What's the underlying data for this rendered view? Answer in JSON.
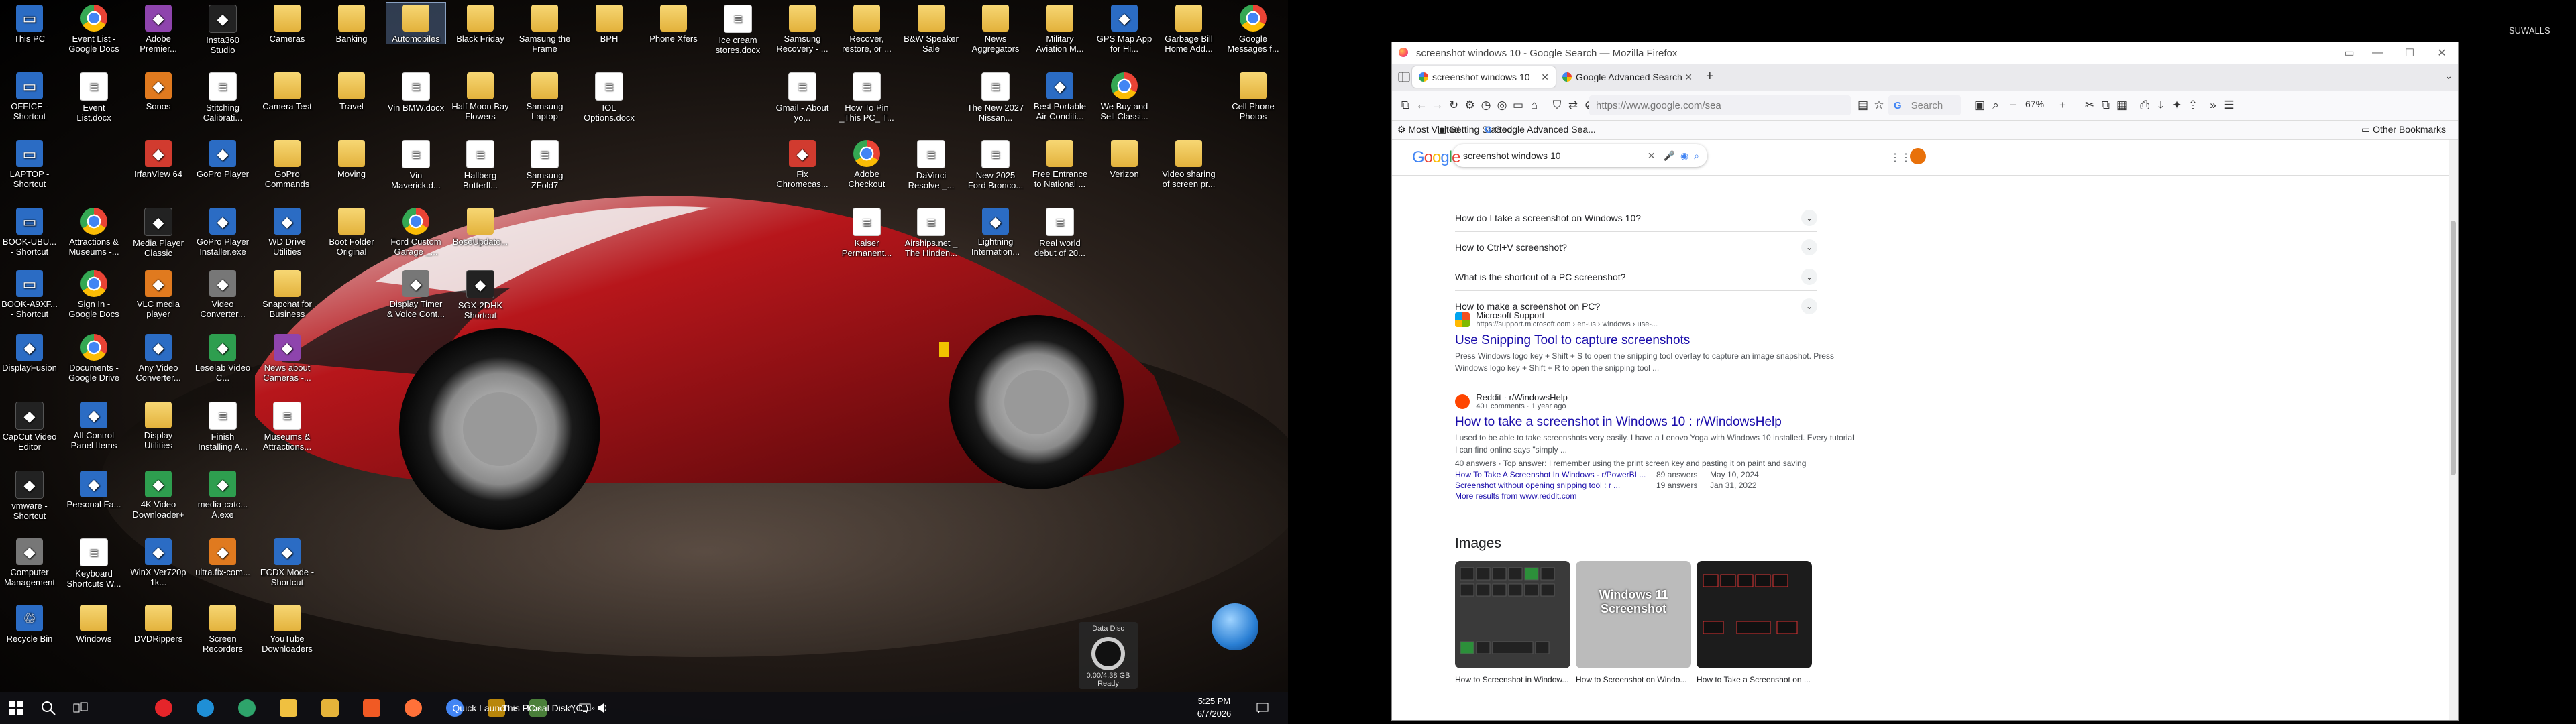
{
  "left_monitor": {
    "desktop_icons": [
      {
        "label": "This PC",
        "icon": "pc-icon",
        "x": 2,
        "y": 2,
        "kind": "app"
      },
      {
        "label": "Event List - Google Docs",
        "icon": "chrome-icon",
        "kind": "chrome"
      },
      {
        "label": "Adobe Premier...",
        "icon": "app-icon",
        "kind": "purple"
      },
      {
        "label": "Insta360 Studio",
        "icon": "app-icon",
        "kind": "dark"
      },
      {
        "label": "Cameras",
        "icon": "folder-icon",
        "kind": "folder"
      },
      {
        "label": "Banking",
        "icon": "folder-icon",
        "kind": "folder"
      },
      {
        "label": "Automobiles",
        "icon": "folder-icon",
        "kind": "folder",
        "selected": true
      },
      {
        "label": "Black Friday",
        "icon": "folder-icon",
        "kind": "folder"
      },
      {
        "label": "Samsung the Frame",
        "icon": "folder-icon",
        "kind": "folder"
      },
      {
        "label": "BPH",
        "icon": "folder-icon",
        "kind": "folder"
      },
      {
        "label": "Phone Xfers",
        "icon": "folder-icon",
        "kind": "folder"
      },
      {
        "label": "Ice cream stores.docx",
        "icon": "document-icon",
        "kind": "doc"
      },
      {
        "label": "Samsung Recovery - ...",
        "icon": "folder-icon",
        "kind": "folder"
      },
      {
        "label": "Recover, restore, or ...",
        "icon": "folder-icon",
        "kind": "folder"
      },
      {
        "label": "B&W Speaker Sale",
        "icon": "folder-icon",
        "kind": "folder"
      },
      {
        "label": "News Aggregators",
        "icon": "folder-icon",
        "kind": "folder"
      },
      {
        "label": "Military Aviation M...",
        "icon": "folder-icon",
        "kind": "folder"
      },
      {
        "label": "GPS Map App for Hi...",
        "icon": "app-icon",
        "kind": "app"
      },
      {
        "label": "Garbage Bill Home Add...",
        "icon": "folder-icon",
        "kind": "folder"
      },
      {
        "label": "Google Messages f...",
        "icon": "chrome-icon",
        "kind": "chrome"
      },
      {
        "label": "OFFICE - Shortcut",
        "icon": "pc-icon",
        "kind": "app"
      },
      {
        "label": "Event List.docx",
        "icon": "document-icon",
        "kind": "doc"
      },
      {
        "label": "Sonos",
        "icon": "app-icon",
        "kind": "orange"
      },
      {
        "label": "Stitching Calibrati...",
        "icon": "document-icon",
        "kind": "doc"
      },
      {
        "label": "Camera Test",
        "icon": "folder-icon",
        "kind": "folder"
      },
      {
        "label": "Travel",
        "icon": "folder-icon",
        "kind": "folder"
      },
      {
        "label": "Vin BMW.docx",
        "icon": "document-icon",
        "kind": "doc"
      },
      {
        "label": "Half Moon Bay Flowers",
        "icon": "folder-icon",
        "kind": "folder"
      },
      {
        "label": "Samsung Laptop",
        "icon": "folder-icon",
        "kind": "folder"
      },
      {
        "label": "IOL Options.docx",
        "icon": "document-icon",
        "kind": "doc"
      },
      {
        "label": "Gmail - About yo...",
        "icon": "document-icon",
        "kind": "doc"
      },
      {
        "label": "How To Pin _This PC_ T...",
        "icon": "document-icon",
        "kind": "doc"
      },
      {
        "label": "The New 2027 Nissan...",
        "icon": "document-icon",
        "kind": "doc"
      },
      {
        "label": "Best Portable Air Conditi...",
        "icon": "app-icon",
        "kind": "app"
      },
      {
        "label": "We Buy and Sell Classi...",
        "icon": "chrome-icon",
        "kind": "chrome"
      },
      {
        "label": "Cell Phone Photos",
        "icon": "folder-icon",
        "kind": "folder"
      },
      {
        "label": "LAPTOP - Shortcut",
        "icon": "pc-icon",
        "kind": "app"
      },
      {
        "label": "IrfanView 64",
        "icon": "app-icon",
        "kind": "red"
      },
      {
        "label": "GoPro Player",
        "icon": "app-icon",
        "kind": "app"
      },
      {
        "label": "GoPro Commands",
        "icon": "folder-icon",
        "kind": "folder"
      },
      {
        "label": "Moving",
        "icon": "folder-icon",
        "kind": "folder"
      },
      {
        "label": "Vin Maverick.d...",
        "icon": "document-icon",
        "kind": "doc"
      },
      {
        "label": "Hallberg Butterfl...",
        "icon": "document-icon",
        "kind": "doc"
      },
      {
        "label": "Samsung ZFold7",
        "icon": "document-icon",
        "kind": "doc"
      },
      {
        "label": "Fix Chromecas...",
        "icon": "app-icon",
        "kind": "red"
      },
      {
        "label": "Adobe Checkout",
        "icon": "chrome-icon",
        "kind": "chrome"
      },
      {
        "label": "DaVinci Resolve _...",
        "icon": "document-icon",
        "kind": "doc"
      },
      {
        "label": "New 2025 Ford Bronco...",
        "icon": "document-icon",
        "kind": "doc"
      },
      {
        "label": "Free Entrance to National ...",
        "icon": "folder-icon",
        "kind": "folder"
      },
      {
        "label": "Verizon",
        "icon": "folder-icon",
        "kind": "folder"
      },
      {
        "label": "Video sharing of screen pr...",
        "icon": "folder-icon",
        "kind": "folder"
      },
      {
        "label": "BOOK-UBU... - Shortcut",
        "icon": "pc-icon",
        "kind": "app"
      },
      {
        "label": "Attractions & Museums -...",
        "icon": "chrome-icon",
        "kind": "chrome"
      },
      {
        "label": "Media Player Classic",
        "icon": "app-icon",
        "kind": "dark"
      },
      {
        "label": "GoPro Player Installer.exe",
        "icon": "app-icon",
        "kind": "app"
      },
      {
        "label": "WD Drive Utilities",
        "icon": "app-icon",
        "kind": "app"
      },
      {
        "label": "Boot Folder Original",
        "icon": "folder-icon",
        "kind": "folder"
      },
      {
        "label": "Ford Custom Garage _...",
        "icon": "chrome-icon",
        "kind": "chrome"
      },
      {
        "label": "BoseUpdate...",
        "icon": "folder-icon",
        "kind": "folder"
      },
      {
        "label": "Kaiser Permanent...",
        "icon": "document-icon",
        "kind": "doc"
      },
      {
        "label": "Airships.net _ The Hinden...",
        "icon": "document-icon",
        "kind": "doc"
      },
      {
        "label": "Lightning Internation...",
        "icon": "app-icon",
        "kind": "app"
      },
      {
        "label": "Real world debut of 20...",
        "icon": "document-icon",
        "kind": "doc"
      },
      {
        "label": "BOOK-A9XF... - Shortcut",
        "icon": "pc-icon",
        "kind": "app"
      },
      {
        "label": "Sign In - Google Docs",
        "icon": "chrome-icon",
        "kind": "chrome"
      },
      {
        "label": "VLC media player",
        "icon": "app-icon",
        "kind": "orange"
      },
      {
        "label": "Video Converter...",
        "icon": "app-icon",
        "kind": "gray"
      },
      {
        "label": "Snapchat for Business",
        "icon": "folder-icon",
        "kind": "folder"
      },
      {
        "label": "Display Timer & Voice Cont...",
        "icon": "app-icon",
        "kind": "gray"
      },
      {
        "label": "SGX-2DHK Shortcut",
        "icon": "app-icon",
        "kind": "dark"
      },
      {
        "label": "DisplayFusion",
        "icon": "app-icon",
        "kind": "app"
      },
      {
        "label": "Documents - Google Drive",
        "icon": "chrome-icon",
        "kind": "chrome"
      },
      {
        "label": "Any Video Converter...",
        "icon": "app-icon",
        "kind": "app"
      },
      {
        "label": "Leselab Video C...",
        "icon": "app-icon",
        "kind": "green"
      },
      {
        "label": "News about Cameras -...",
        "icon": "app-icon",
        "kind": "purple"
      },
      {
        "label": "CapCut Video Editor",
        "icon": "app-icon",
        "kind": "dark"
      },
      {
        "label": "All Control Panel Items",
        "icon": "app-icon",
        "kind": "app"
      },
      {
        "label": "Display Utilities",
        "icon": "folder-icon",
        "kind": "folder"
      },
      {
        "label": "Finish Installing A...",
        "icon": "document-icon",
        "kind": "doc"
      },
      {
        "label": "Museums & Attractions...",
        "icon": "document-icon",
        "kind": "doc"
      },
      {
        "label": "vmware - Shortcut",
        "icon": "app-icon",
        "kind": "dark"
      },
      {
        "label": "Personal Fa...",
        "icon": "app-icon",
        "kind": "app"
      },
      {
        "label": "4K Video Downloader+",
        "icon": "app-icon",
        "kind": "green"
      },
      {
        "label": "media-catc... A.exe",
        "icon": "app-icon",
        "kind": "green"
      },
      {
        "label": "Computer Management",
        "icon": "app-icon",
        "kind": "gray"
      },
      {
        "label": "Keyboard Shortcuts W...",
        "icon": "document-icon",
        "kind": "doc"
      },
      {
        "label": "WinX Ver720p 1k...",
        "icon": "app-icon",
        "kind": "app"
      },
      {
        "label": "ultra.fix-com...",
        "icon": "app-icon",
        "kind": "orange"
      },
      {
        "label": "ECDX Mode - Shortcut",
        "icon": "app-icon",
        "kind": "app"
      },
      {
        "label": "Recycle Bin",
        "icon": "recycle-bin-icon",
        "kind": "app"
      },
      {
        "label": "Windows",
        "icon": "folder-icon",
        "kind": "folder"
      },
      {
        "label": "DVDRippers",
        "icon": "folder-icon",
        "kind": "folder"
      },
      {
        "label": "Screen Recorders",
        "icon": "folder-icon",
        "kind": "folder"
      },
      {
        "label": "YouTube Downloaders",
        "icon": "folder-icon",
        "kind": "folder"
      }
    ],
    "data_disc": {
      "title": "Data Disc",
      "size": "0.00/4.38 GB",
      "state": "Ready"
    },
    "taskbar": {
      "toolbars": [
        "Quick Launch",
        "This PC",
        "Local Disk (C:)"
      ],
      "clock_time": "5:25 PM",
      "clock_date": "6/7/2026",
      "pinned": [
        {
          "name": "youtube-music-icon",
          "color": "#e5252a"
        },
        {
          "name": "edge-icon",
          "color": "#1f8fd6"
        },
        {
          "name": "edge-alt-icon",
          "color": "#2ea46b"
        },
        {
          "name": "file-explorer-icon",
          "color": "#f0c040"
        },
        {
          "name": "folder-icon",
          "color": "#e5b33a"
        },
        {
          "name": "brave-icon",
          "color": "#f05a24"
        },
        {
          "name": "firefox-icon",
          "color": "#ff7139"
        },
        {
          "name": "chrome-icon",
          "color": "#4285f4"
        },
        {
          "name": "sonos-icon",
          "color": "#b8860b"
        },
        {
          "name": "app-icon",
          "color": "#4a7f3a"
        }
      ]
    }
  },
  "right_monitor": {
    "username": "SUWALLS",
    "firefox": {
      "window_title": "screenshot windows 10 - Google Search — Mozilla Firefox",
      "tabs": [
        {
          "label": "screenshot windows 10 - Goog",
          "active": true
        },
        {
          "label": "Google Advanced Search",
          "active": false
        }
      ],
      "url": "https://www.google.com/sea",
      "search_placeholder": "Search",
      "zoom": "67%",
      "bookmarks": [
        "Most Visited",
        "Getting Started",
        "Google Advanced Sea..."
      ],
      "other_bookmarks": "Other Bookmarks",
      "google": {
        "query": "screenshot windows 10",
        "people_also_ask": [
          "How do I take a screenshot on Windows 10?",
          "How to Ctrl+V screenshot?",
          "What is the shortcut of a PC screenshot?",
          "How to make a screenshot on PC?"
        ],
        "results": [
          {
            "site": "Microsoft Support",
            "url": "https://support.microsoft.com › en-us › windows › use-...",
            "title": "Use Snipping Tool to capture screenshots",
            "snippet": "Press Windows logo key + Shift + S to open the snipping tool overlay to capture an image snapshot. Press Windows logo key + Shift + R to open the snipping tool ..."
          },
          {
            "site": "Reddit · r/WindowsHelp",
            "url": "40+ comments · 1 year ago",
            "title": "How to take a screenshot in Windows 10 : r/WindowsHelp",
            "snippet": "I used to be able to take screenshots very easily. I have a Lenovo Yoga with Windows 10 installed. Every tutorial I can find online says \"simply ...",
            "answer": "40 answers · Top answer: I remember using the print screen key and pasting it on paint and saving",
            "sublinks": [
              {
                "text": "How To Take A Screenshot In Windows · r/PowerBI ...",
                "meta": "89 answers",
                "date": "May 10, 2024"
              },
              {
                "text": "Screenshot without opening snipping tool : r ...",
                "meta": "19 answers",
                "date": "Jan 31, 2022"
              }
            ],
            "more": "More results from www.reddit.com"
          }
        ],
        "images_heading": "Images",
        "image_captions": [
          "How to Screenshot in Window...",
          "How to Screenshot on Windo...",
          "How to Take a Screenshot on ..."
        ],
        "thumb2_text": "Windows 11 Screenshot"
      }
    }
  }
}
